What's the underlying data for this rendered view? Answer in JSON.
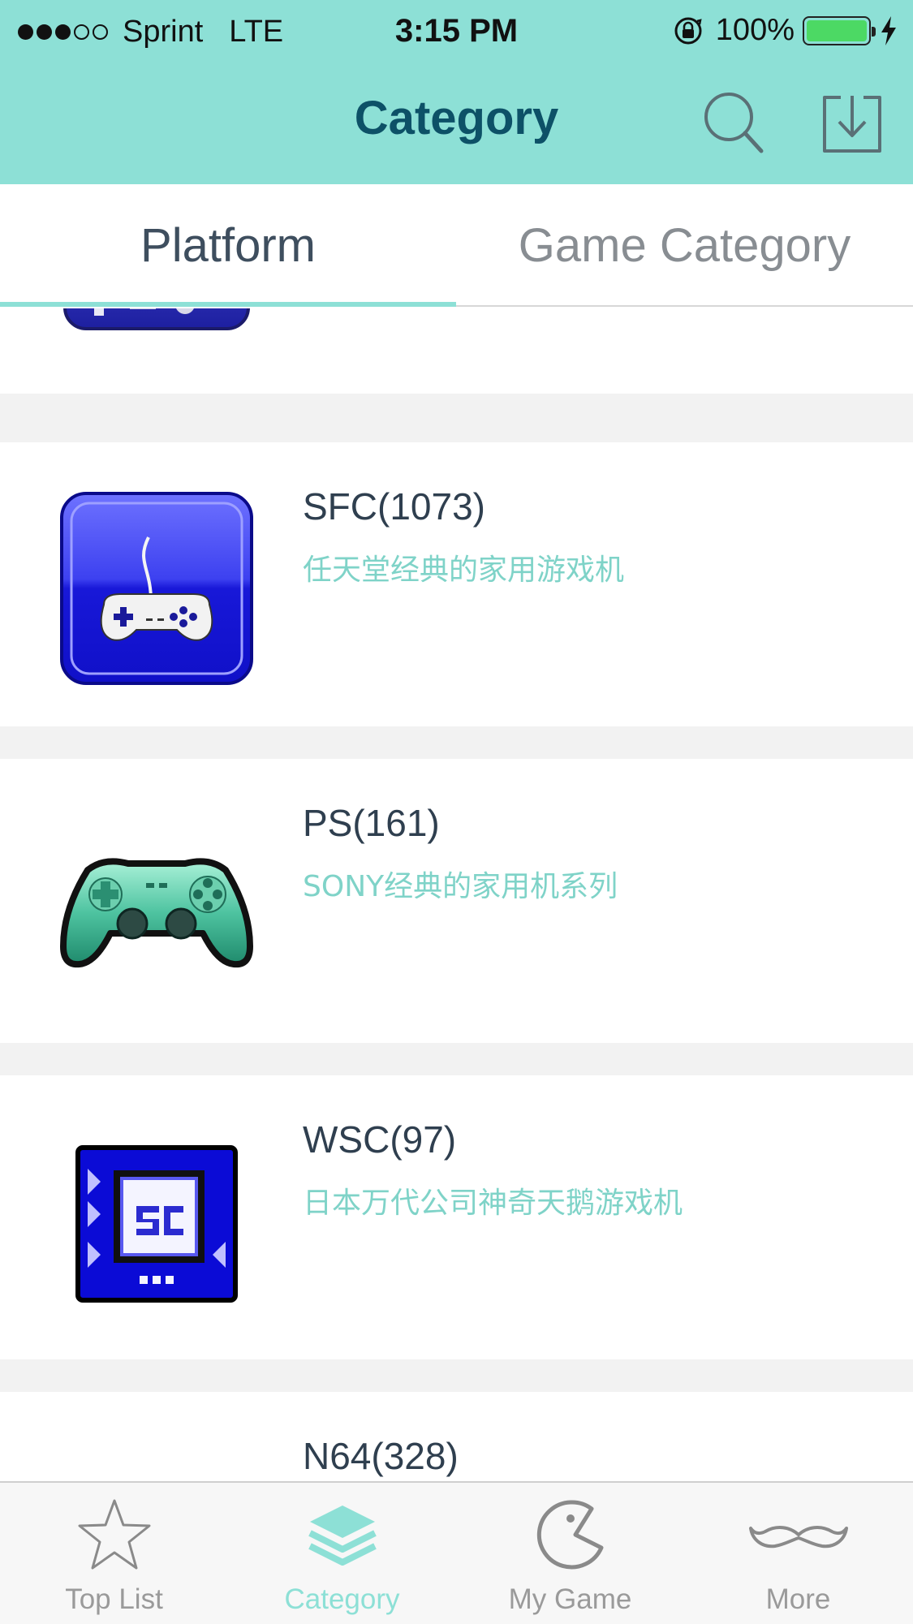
{
  "status_bar": {
    "carrier": "Sprint",
    "network": "LTE",
    "time": "3:15 PM",
    "battery": "100%",
    "battery_level": 1.0,
    "signal_bars_filled": 3,
    "signal_bars_total": 5
  },
  "nav": {
    "title": "Category"
  },
  "tabs": [
    {
      "label": "Platform",
      "active": true
    },
    {
      "label": "Game Category",
      "active": false
    }
  ],
  "platforms": [
    {
      "title": "",
      "desc": "",
      "icon": "gba-gamepad-icon"
    },
    {
      "title": "SFC(1073)",
      "desc": "任天堂经典的家用游戏机",
      "icon": "sfc-controller-icon"
    },
    {
      "title": "PS(161)",
      "desc": "SONY经典的家用机系列",
      "icon": "ps-controller-icon"
    },
    {
      "title": "WSC(97)",
      "desc": "日本万代公司神奇天鹅游戏机",
      "icon": "wsc-console-icon"
    },
    {
      "title": "N64(328)",
      "desc": "",
      "icon": "n64-icon"
    }
  ],
  "tabbar": [
    {
      "label": "Top List",
      "icon": "star-icon",
      "active": false
    },
    {
      "label": "Category",
      "icon": "layers-icon",
      "active": true
    },
    {
      "label": "My Game",
      "icon": "pacman-icon",
      "active": false
    },
    {
      "label": "More",
      "icon": "mustache-icon",
      "active": false
    }
  ],
  "colors": {
    "accent": "#8de0d6",
    "title_dark": "#0d5167",
    "desc_text": "#7fd3c8"
  }
}
